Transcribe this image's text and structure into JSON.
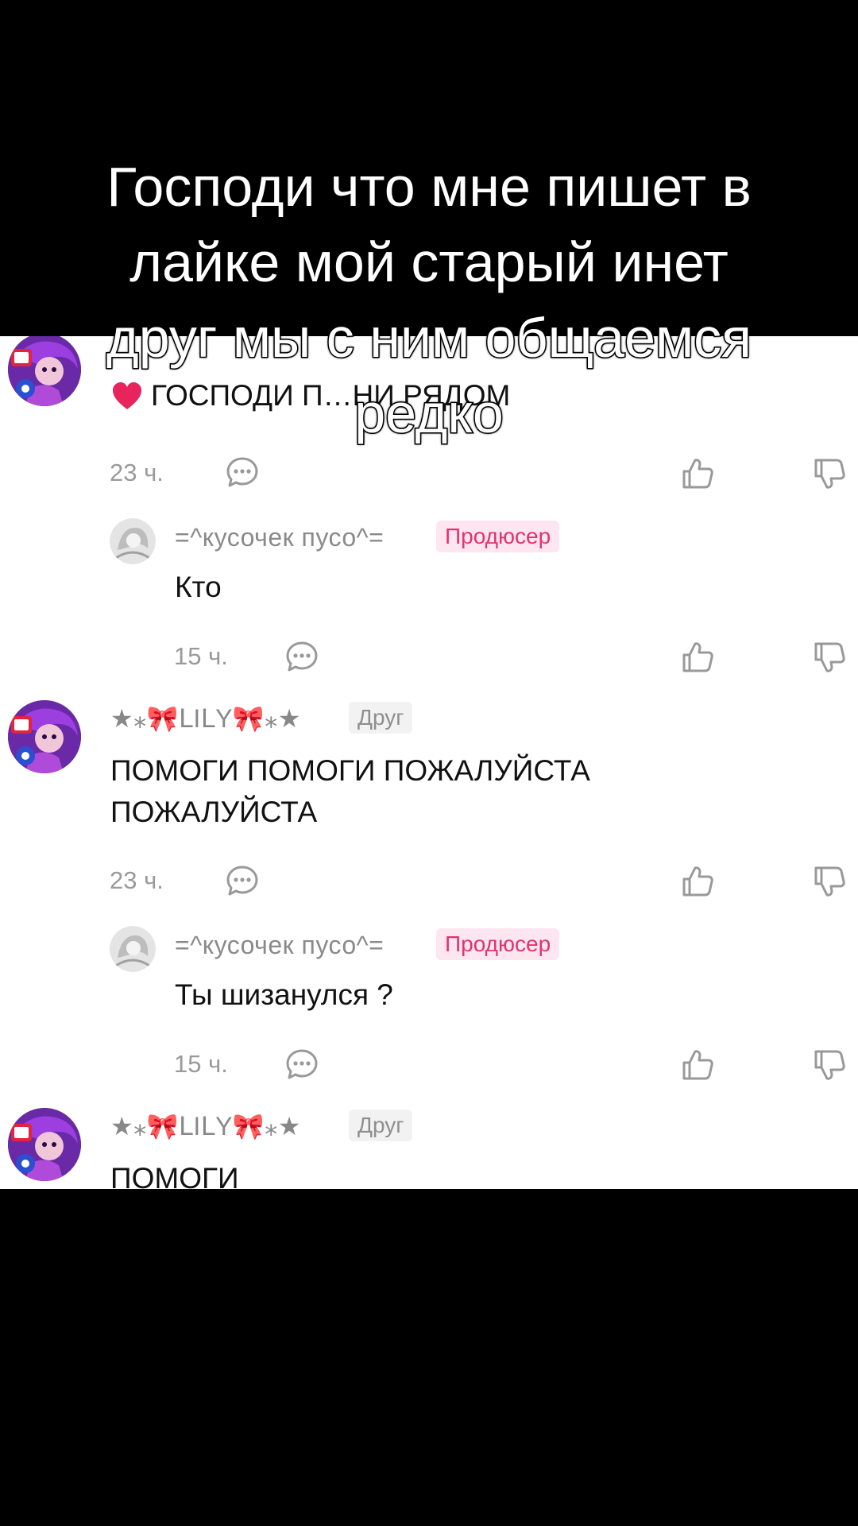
{
  "caption": {
    "line1": "Господи что мне пишет в",
    "line2": "лайке мой старый инет",
    "line3": "друг мы с ним общаемся",
    "line4": "редко"
  },
  "comments": [
    {
      "type": "top",
      "text": "ГОСПОДИ П…НИ РЯДОМ",
      "time": "23 ч.",
      "heart_color": "#e8245c"
    },
    {
      "type": "reply",
      "username": "=^кусочек пусо^=",
      "badge": "Продюсер",
      "text": "Кто",
      "time": "15 ч."
    },
    {
      "type": "top",
      "username": "★⁎🎀ᒪIᒪY🎀⁎★",
      "badge": "Друг",
      "text_line1": "ПОМОГИ ПОМОГИ ПОЖАЛУЙСТА",
      "text_line2": "ПОЖАЛУЙСТА",
      "time": "23 ч."
    },
    {
      "type": "reply",
      "username": "=^кусочек пусо^=",
      "badge": "Продюсер",
      "text": "Ты шизанулся ?",
      "time": "15 ч."
    },
    {
      "type": "top",
      "username": "★⁎🎀ᒪIᒪY🎀⁎★",
      "badge": "Друг",
      "text": "ПОМОГИ"
    }
  ],
  "icons": {
    "reply": "comment-bubble-icon",
    "like": "thumbs-up-icon",
    "dislike": "thumbs-down-icon"
  },
  "colors": {
    "producer_badge_bg": "#fde6ef",
    "producer_badge_text": "#e2336f",
    "friend_badge_bg": "#f2f2f2"
  }
}
